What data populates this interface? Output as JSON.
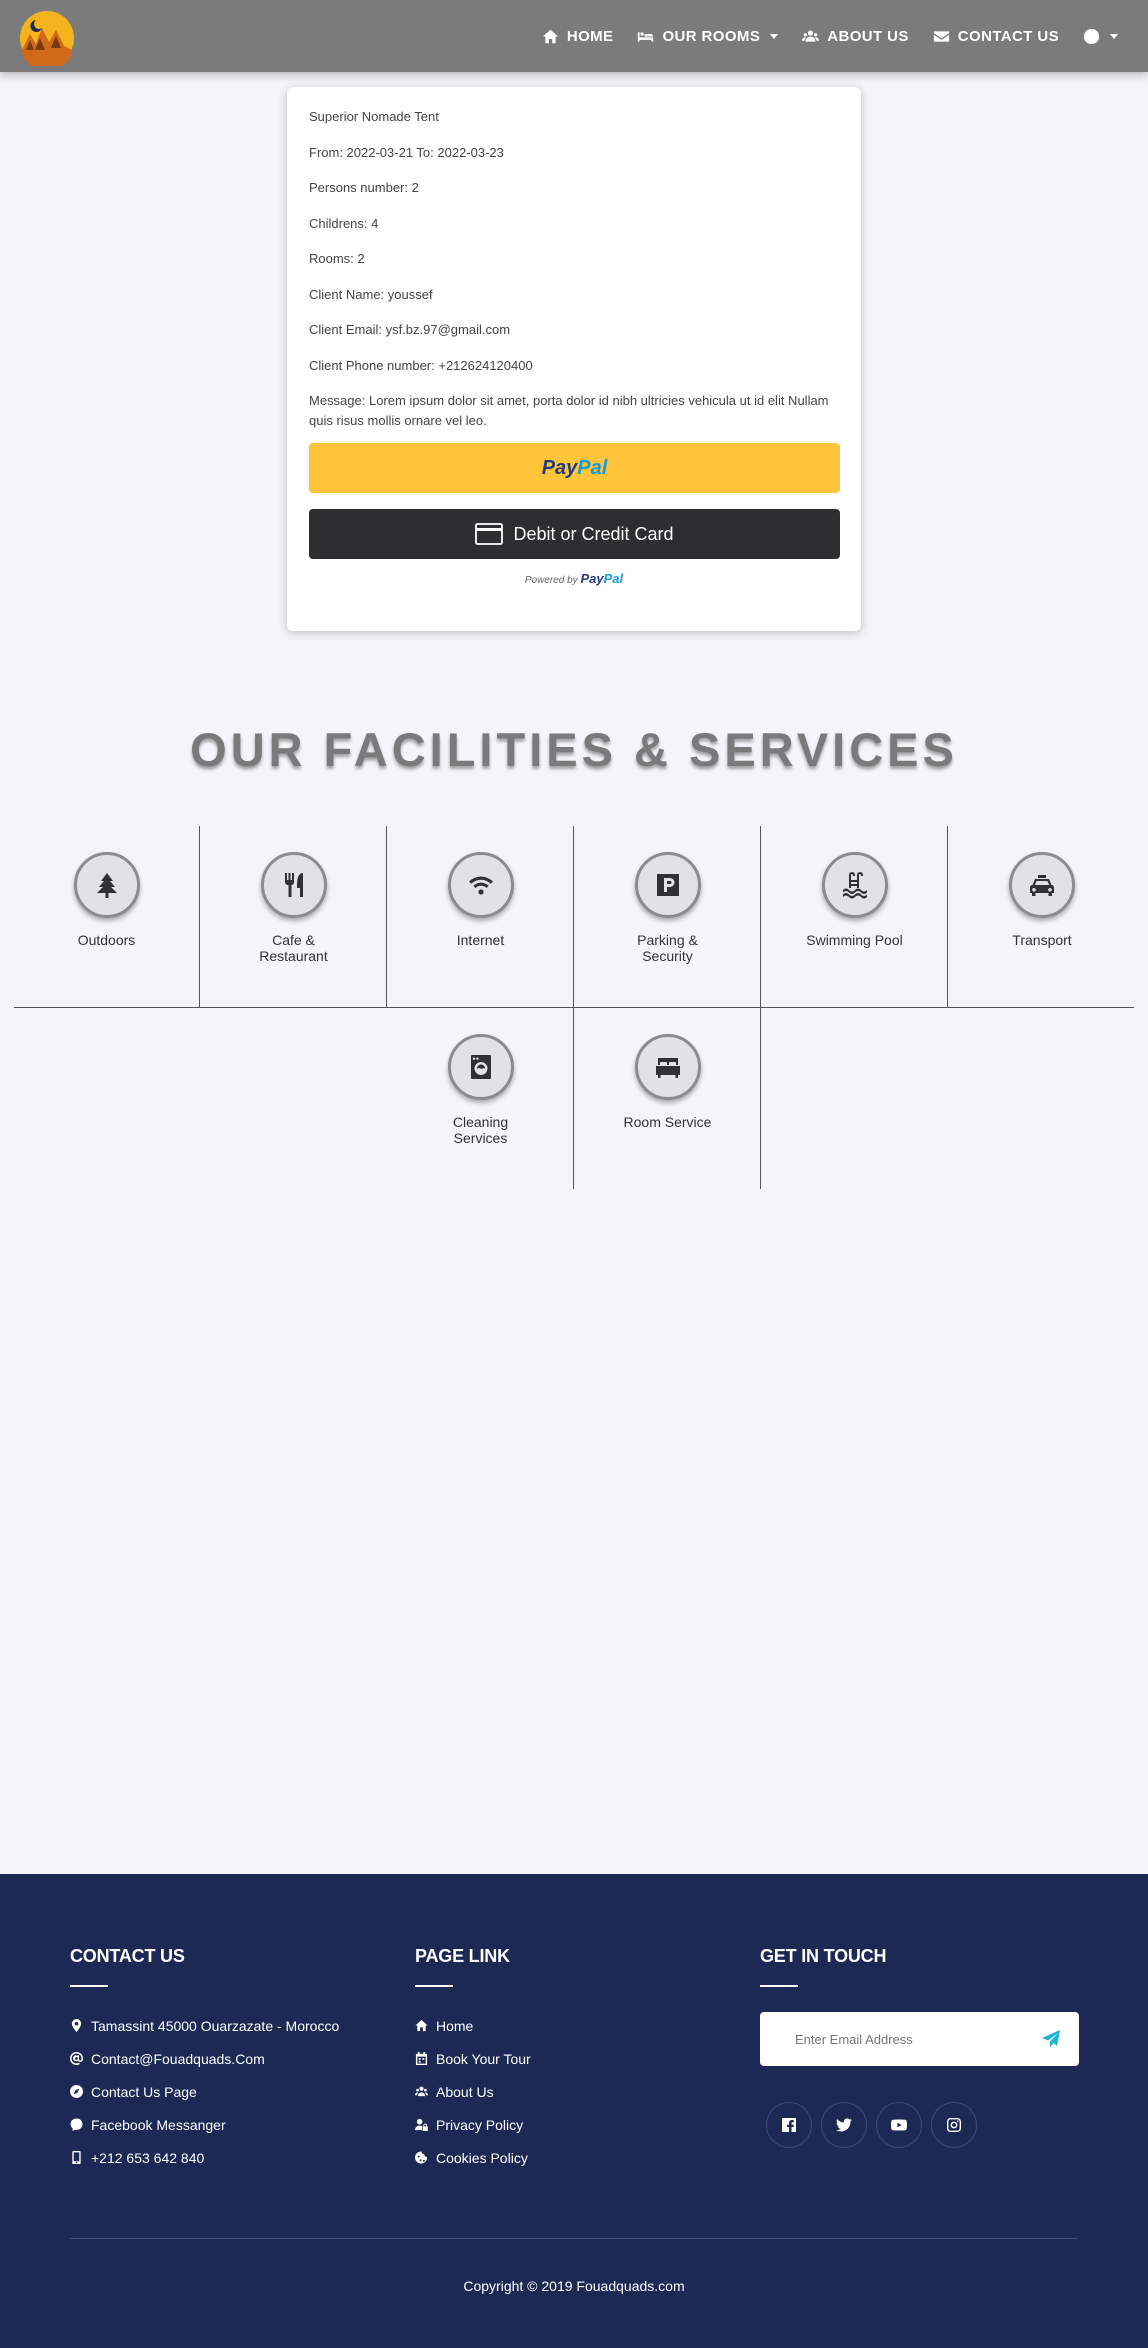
{
  "nav": {
    "items": [
      {
        "label": "HOME",
        "icon": "home-icon"
      },
      {
        "label": "OUR ROOMS",
        "icon": "bed-icon"
      },
      {
        "label": "ABOUT US",
        "icon": "users-icon"
      },
      {
        "label": "CONTACT US",
        "icon": "envelope-icon"
      },
      {
        "label": "",
        "icon": "globe-icon"
      }
    ]
  },
  "booking": {
    "room": "Superior Nomade Tent",
    "dates": "From: 2022-03-21 To: 2022-03-23",
    "persons": "Persons number: 2",
    "childrens": "Childrens: 4",
    "rooms": "Rooms: 2",
    "client_name": "Client Name: youssef",
    "client_email": "Client Email: ysf.bz.97@gmail.com",
    "client_phone": "Client Phone number: +212624120400",
    "message": "Message: Lorem ipsum dolor sit amet, porta dolor id nibh ultricies vehicula ut id elit Nullam quis risus mollis ornare vel leo."
  },
  "paypal": {
    "logo_pay": "Pay",
    "logo_pal": "Pal",
    "card_button": "Debit or Credit Card",
    "powered_by": "Powered by",
    "colors": {
      "gold": "#ffc439",
      "dark": "#2c2e2f"
    }
  },
  "facilities": {
    "title": "OUR FACILITIES & SERVICES",
    "items": [
      {
        "label": "Outdoors",
        "icon": "tree-icon"
      },
      {
        "label": "Cafe & Restaurant",
        "icon": "utensils-icon"
      },
      {
        "label": "Internet",
        "icon": "wifi-icon"
      },
      {
        "label": "Parking & Security",
        "icon": "parking-icon"
      },
      {
        "label": "Swimming Pool",
        "icon": "swimming-pool-icon"
      },
      {
        "label": "Transport",
        "icon": "taxi-icon"
      },
      {
        "label": "Cleaning Services",
        "icon": "washing-machine-icon"
      },
      {
        "label": "Room Service",
        "icon": "bed-icon"
      }
    ]
  },
  "footer": {
    "contact": {
      "title": "CONTACT US",
      "items": [
        {
          "label": "Tamassint 45000 Ouarzazate - Morocco",
          "icon": "map-marker-icon"
        },
        {
          "label": "Contact@Fouadquads.Com",
          "icon": "at-icon"
        },
        {
          "label": "Contact Us Page",
          "icon": "compass-icon"
        },
        {
          "label": "Facebook Messanger",
          "icon": "messenger-icon"
        },
        {
          "label": "+212 653 642 840",
          "icon": "mobile-icon"
        }
      ]
    },
    "pages": {
      "title": "PAGE LINK",
      "items": [
        {
          "label": "Home",
          "icon": "home-icon"
        },
        {
          "label": "Book Your Tour",
          "icon": "calendar-icon"
        },
        {
          "label": "About Us",
          "icon": "users-icon"
        },
        {
          "label": "Privacy Policy",
          "icon": "user-lock-icon"
        },
        {
          "label": "Cookies Policy",
          "icon": "cookie-icon"
        }
      ]
    },
    "touch": {
      "title": "GET IN TOUCH",
      "email_placeholder": "Enter Email Address",
      "socials": [
        "facebook-icon",
        "twitter-icon",
        "youtube-icon",
        "instagram-icon"
      ]
    },
    "copyright": "Copyright © 2019 Fouadquads.com",
    "colors": {
      "background": "#1b2954",
      "accent": "#1fb2d7"
    }
  }
}
